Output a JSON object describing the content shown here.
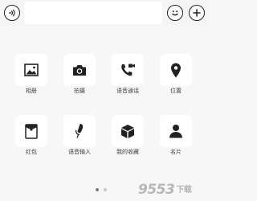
{
  "toolbar": {
    "voice_icon": "voice-icon",
    "emoji_icon": "emoji-icon",
    "plus_icon": "plus-icon",
    "input_value": "",
    "input_placeholder": ""
  },
  "panel": {
    "items": [
      {
        "label": "相册",
        "icon": "image-icon"
      },
      {
        "label": "拍摄",
        "icon": "camera-icon"
      },
      {
        "label": "语音通话",
        "icon": "phone-video-icon"
      },
      {
        "label": "位置",
        "icon": "location-pin-icon"
      },
      {
        "label": "红包",
        "icon": "red-packet-icon"
      },
      {
        "label": "语音输入",
        "icon": "microphone-icon"
      },
      {
        "label": "我的收藏",
        "icon": "cube-icon"
      },
      {
        "label": "名片",
        "icon": "person-card-icon"
      }
    ]
  },
  "pager": {
    "pages": 2,
    "current": 1
  },
  "watermark": {
    "text": "9553",
    "sub": "下载"
  }
}
